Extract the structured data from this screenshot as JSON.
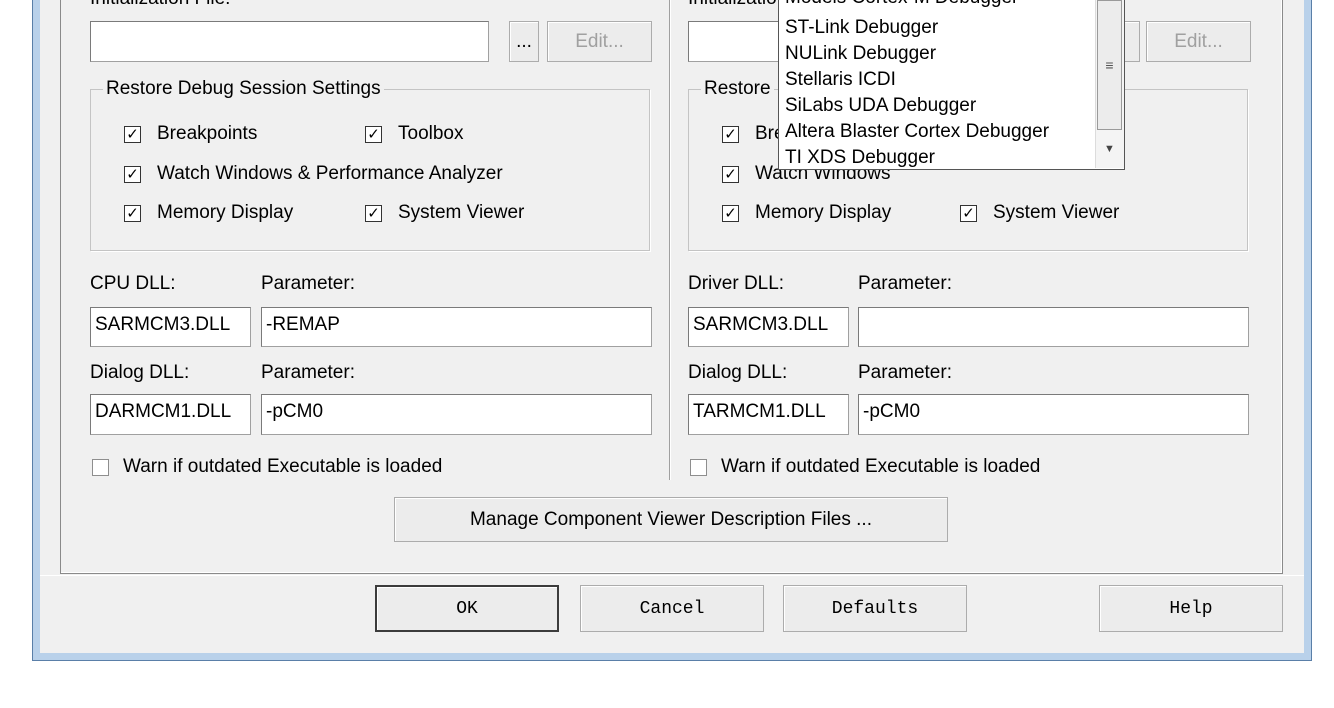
{
  "left": {
    "init_file_label": "Initialization File:",
    "init_file_value": "",
    "browse_label": "...",
    "edit_label": "Edit...",
    "restore_title": "Restore Debug Session Settings",
    "cb_breakpoints": "Breakpoints",
    "cb_toolbox": "Toolbox",
    "cb_watch": "Watch Windows & Performance Analyzer",
    "cb_memory": "Memory Display",
    "cb_system": "System Viewer",
    "cpu_dll_label": "CPU DLL:",
    "cpu_param_label": "Parameter:",
    "cpu_dll_value": "SARMCM3.DLL",
    "cpu_param_value": "-REMAP",
    "dialog_dll_label": "Dialog DLL:",
    "dialog_param_label": "Parameter:",
    "dialog_dll_value": "DARMCM1.DLL",
    "dialog_param_value": "-pCM0",
    "warn_label": "Warn if outdated Executable is loaded"
  },
  "right": {
    "init_file_label": "Initializatio",
    "edit_label": "Edit...",
    "restore_title": "Restore",
    "cb_breakpoints": "Bre",
    "cb_watch": "Watch Windows",
    "cb_memory": "Memory Display",
    "cb_system": "System Viewer",
    "driver_dll_label": "Driver DLL:",
    "driver_param_label": "Parameter:",
    "driver_dll_value": "SARMCM3.DLL",
    "driver_param_value": "",
    "dialog_dll_label": "Dialog DLL:",
    "dialog_param_label": "Parameter:",
    "dialog_dll_value": "TARMCM1.DLL",
    "dialog_param_value": "-pCM0",
    "warn_label": "Warn if outdated Executable is loaded"
  },
  "dropdown": {
    "items": [
      "Models Cortex-M Debugger",
      "ST-Link Debugger",
      "NULink Debugger",
      "Stellaris ICDI",
      "SiLabs UDA Debugger",
      "Altera Blaster Cortex Debugger",
      "TI XDS Debugger"
    ]
  },
  "manage_button": "Manage Component Viewer Description Files ...",
  "footer": {
    "ok": "OK",
    "cancel": "Cancel",
    "defaults": "Defaults",
    "help": "Help"
  },
  "checkbox_states": {
    "breakpoints": true,
    "toolbox": true,
    "watch": true,
    "memory": true,
    "system": true,
    "warn": false
  }
}
